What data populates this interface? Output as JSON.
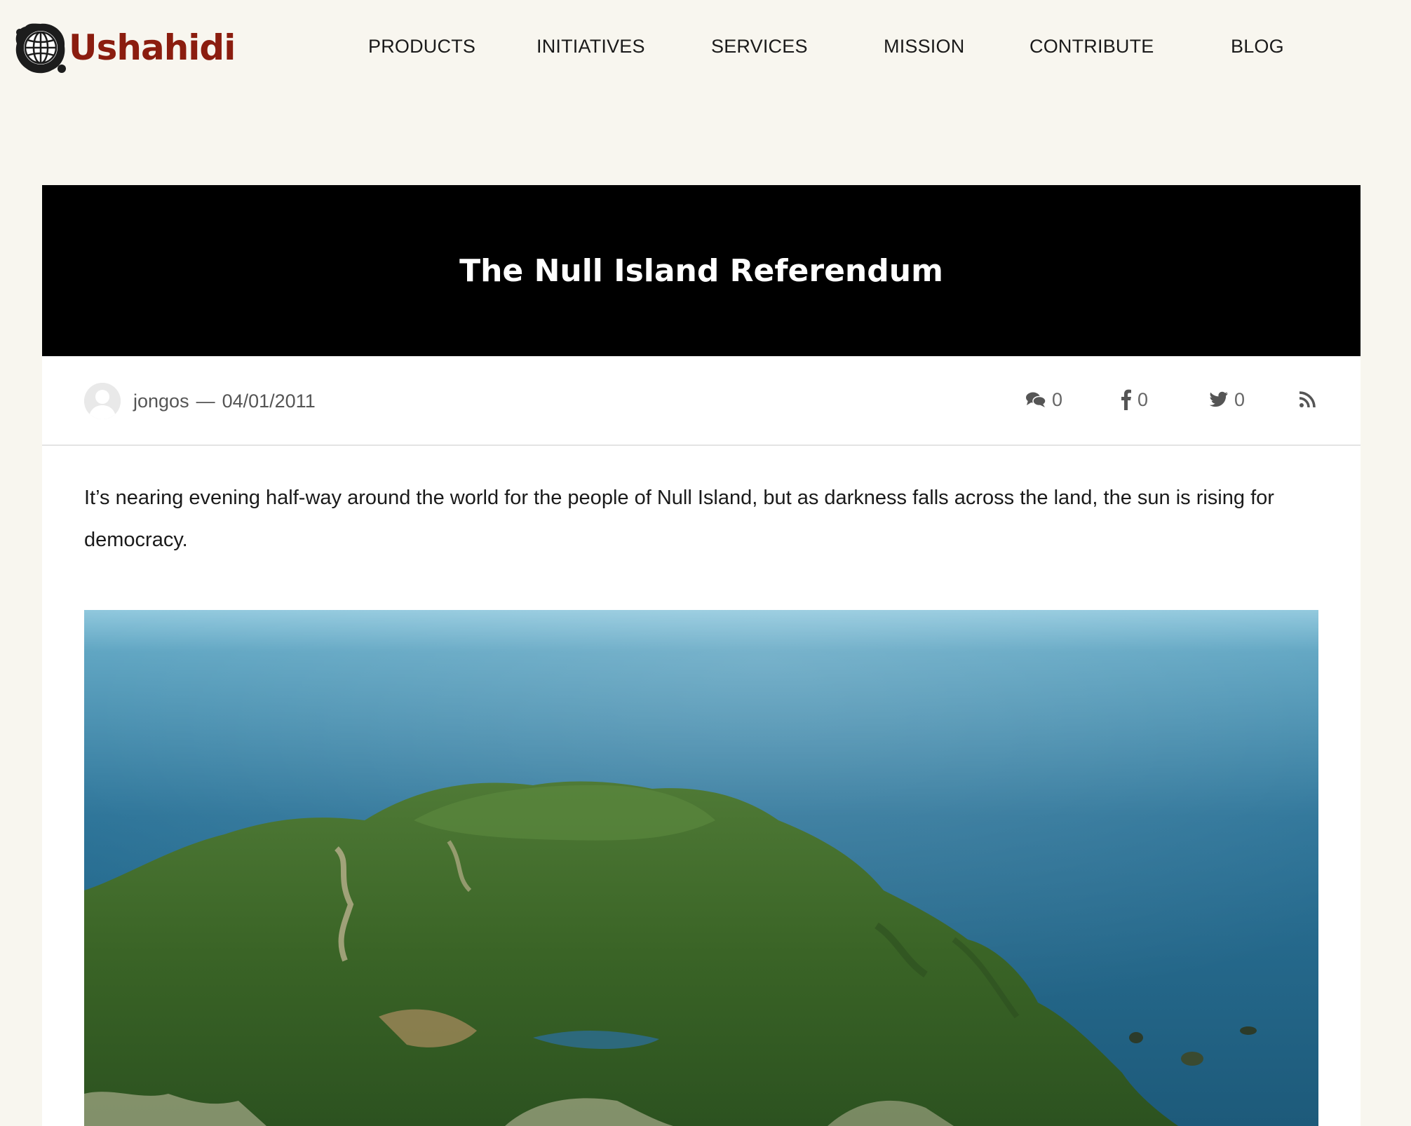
{
  "brand": {
    "name": "Ushahidi",
    "color": "#8b1d0f"
  },
  "nav": {
    "items": [
      {
        "label": "PRODUCTS"
      },
      {
        "label": "INITIATIVES"
      },
      {
        "label": "SERVICES"
      },
      {
        "label": "MISSION"
      },
      {
        "label": "CONTRIBUTE"
      },
      {
        "label": "BLOG"
      }
    ]
  },
  "post": {
    "title": "The Null Island Referendum",
    "author": "jongos",
    "separator": "—",
    "date": "04/01/2011",
    "intro": "It’s nearing evening half-way around the world for the people of Null Island, but as darkness falls across the land, the sun is rising for democracy.",
    "hero_image_icon": "island-aerial-photo"
  },
  "share": {
    "comments": {
      "icon": "comments-icon",
      "count": "0"
    },
    "facebook": {
      "icon": "facebook-icon",
      "count": "0"
    },
    "twitter": {
      "icon": "twitter-icon",
      "count": "0"
    },
    "rss": {
      "icon": "rss-icon"
    }
  }
}
